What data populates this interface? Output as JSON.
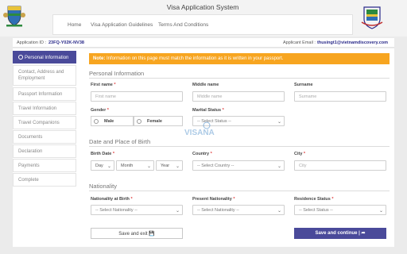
{
  "header": {
    "title": "Visa Application System",
    "nav": [
      "Home",
      "Visa Application Guidelines",
      "Terms And Conditions"
    ]
  },
  "infobar": {
    "app_id_label": "Application ID :",
    "app_id_value": "23FQ-Y02K-NV38",
    "email_label": "Applicant Email :",
    "email_value": "thusingt1@vietnamdiscovery.com"
  },
  "sidebar": {
    "items": [
      "Personal Information",
      "Contact, Address and Employment",
      "Passport Information",
      "Travel Information",
      "Travel Companions",
      "Documents",
      "Declaration",
      "Payments",
      "Complete"
    ],
    "active_index": 0
  },
  "note": {
    "label": "Note:",
    "text": "Information on this page must match the information as it is written in your passport."
  },
  "sections": {
    "personal": "Personal Information",
    "birth": "Date and Place of Birth",
    "nationality": "Nationality"
  },
  "fields": {
    "first_name_label": "First name",
    "first_name_placeholder": "First name",
    "middle_name_label": "Middle name",
    "middle_name_placeholder": "Middle name",
    "surname_label": "Surname",
    "surname_placeholder": "Surname",
    "gender_label": "Gender",
    "gender_male": "Male",
    "gender_female": "Female",
    "marital_label": "Marital Status",
    "marital_value": "-- Select Status --",
    "birth_date_label": "Birth Date",
    "day": "Day",
    "month": "Month",
    "year": "Year",
    "country_label": "Country",
    "country_value": "-- Select Country --",
    "city_label": "City",
    "city_placeholder": "City",
    "nat_birth_label": "Nationality at Birth",
    "nat_birth_value": "-- Select Nationality --",
    "present_nat_label": "Present Nationality",
    "present_nat_value": "-- Select Nationality --",
    "residence_label": "Residence Status",
    "residence_value": "-- Select Status --",
    "required_mark": "*"
  },
  "buttons": {
    "save_exit": "Save and exit",
    "save_continue": "Save and continue"
  },
  "watermark": {
    "brand": "VISANA"
  },
  "colors": {
    "accent": "#4a4a9a",
    "note_bg": "#f7a520",
    "required": "#e04040"
  }
}
